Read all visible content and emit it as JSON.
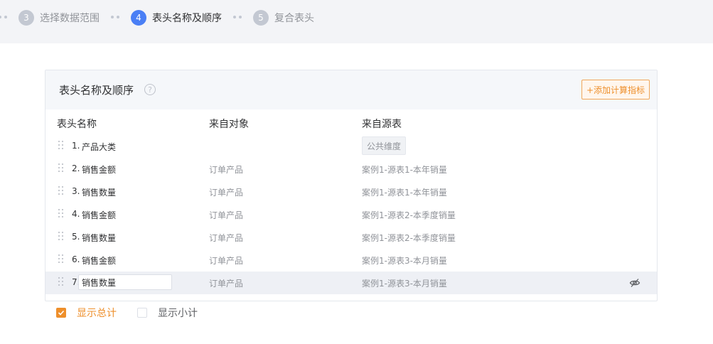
{
  "steps": [
    {
      "num": "3",
      "label": "选择数据范围",
      "active": false
    },
    {
      "num": "4",
      "label": "表头名称及顺序",
      "active": true
    },
    {
      "num": "5",
      "label": "复合表头",
      "active": false
    }
  ],
  "card": {
    "title": "表头名称及顺序",
    "help_icon": "question-circle-icon",
    "add_button": "+添加计算指标",
    "columns": [
      "表头名称",
      "来自对象",
      "来自源表"
    ]
  },
  "rows": [
    {
      "num": "1.",
      "name": "产品大类",
      "object": "",
      "source": "公共维度",
      "source_is_tag": true
    },
    {
      "num": "2.",
      "name": "销售金额",
      "object": "订单产品",
      "source": "案例1-源表1-本年销量"
    },
    {
      "num": "3.",
      "name": "销售数量",
      "object": "订单产品",
      "source": "案例1-源表1-本年销量"
    },
    {
      "num": "4.",
      "name": "销售金额",
      "object": "订单产品",
      "source": "案例1-源表2-本季度销量"
    },
    {
      "num": "5.",
      "name": "销售数量",
      "object": "订单产品",
      "source": "案例1-源表2-本季度销量"
    },
    {
      "num": "6.",
      "name": "销售金额",
      "object": "订单产品",
      "source": "案例1-源表3-本月销量"
    },
    {
      "num": "7.",
      "name": "销售数量",
      "object": "订单产品",
      "source": "案例1-源表3-本月销量",
      "editing": true
    }
  ],
  "footer": {
    "show_total": {
      "label": "显示总计",
      "checked": true
    },
    "show_subtotal": {
      "label": "显示小计",
      "checked": false
    }
  },
  "colors": {
    "accent": "#ee8f2b",
    "step_active": "#4a7ff5"
  }
}
